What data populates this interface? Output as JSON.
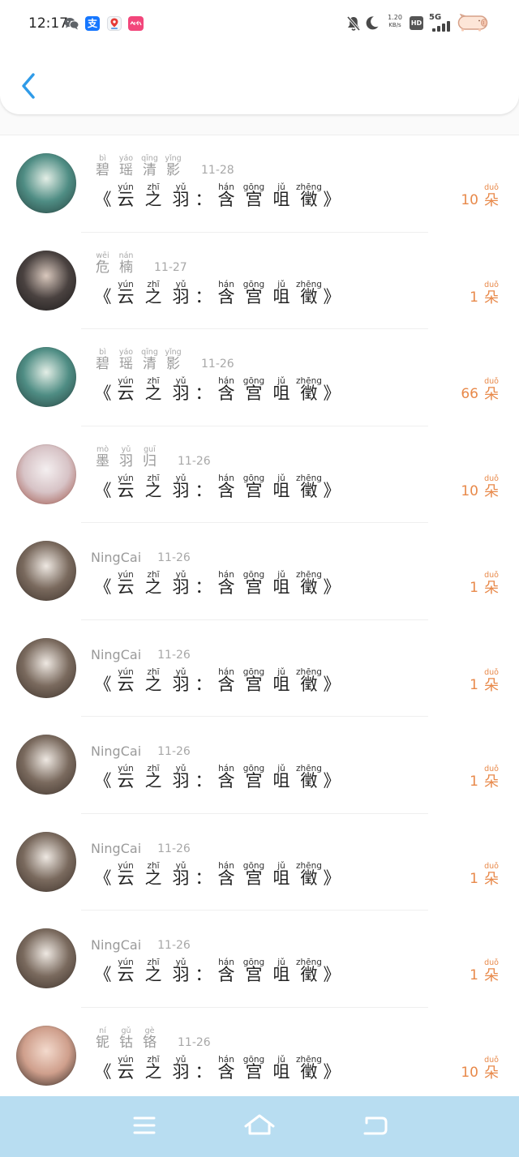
{
  "status_bar": {
    "time": "12:17",
    "alipay_label": "支",
    "speed_value": "1.20",
    "speed_unit": "KB/s",
    "hd_label": "HD",
    "network_label": "5G",
    "icons": [
      "wechat-icon",
      "alipay-icon",
      "map-pin-icon",
      "pink-app-icon",
      "bell-off-icon",
      "moon-icon",
      "signal-icon",
      "battery-icon"
    ]
  },
  "header": {
    "back_icon": "chevron-left-icon",
    "accent_color": "#2f9be8"
  },
  "list": {
    "count_color": "#e8894a",
    "items": [
      {
        "name": [
          {
            "char": "碧",
            "py": "bì"
          },
          {
            "char": "瑶",
            "py": "yáo"
          },
          {
            "char": "清",
            "py": "qīng"
          },
          {
            "char": "影",
            "py": "yǐng"
          }
        ],
        "date": "11-28",
        "title": [
          {
            "char": "《"
          },
          {
            "char": "云",
            "py": "yún"
          },
          {
            "char": "之",
            "py": "zhī"
          },
          {
            "char": "羽",
            "py": "yǔ"
          },
          {
            "char": "："
          },
          {
            "char": "含",
            "py": "hán"
          },
          {
            "char": "宫",
            "py": "gōng"
          },
          {
            "char": "咀",
            "py": "jǔ"
          },
          {
            "char": "徵",
            "py": "zhēng"
          },
          {
            "char": "》"
          }
        ],
        "count": "10",
        "unit": {
          "char": "朵",
          "py": "duǒ"
        },
        "avatar_colors": [
          "#e3eee6",
          "#4f8d84",
          "#24403d"
        ]
      },
      {
        "name": [
          {
            "char": "危",
            "py": "wēi"
          },
          {
            "char": "楠",
            "py": "nán"
          }
        ],
        "date": "11-27",
        "title": [
          {
            "char": "《"
          },
          {
            "char": "云",
            "py": "yún"
          },
          {
            "char": "之",
            "py": "zhī"
          },
          {
            "char": "羽",
            "py": "yǔ"
          },
          {
            "char": "："
          },
          {
            "char": "含",
            "py": "hán"
          },
          {
            "char": "宫",
            "py": "gōng"
          },
          {
            "char": "咀",
            "py": "jǔ"
          },
          {
            "char": "徵",
            "py": "zhēng"
          },
          {
            "char": "》"
          }
        ],
        "count": "1",
        "unit": {
          "char": "朵",
          "py": "duǒ"
        },
        "avatar_colors": [
          "#d9c8bd",
          "#4a4240",
          "#1b1a1a"
        ]
      },
      {
        "name": [
          {
            "char": "碧",
            "py": "bì"
          },
          {
            "char": "瑶",
            "py": "yáo"
          },
          {
            "char": "清",
            "py": "qīng"
          },
          {
            "char": "影",
            "py": "yǐng"
          }
        ],
        "date": "11-26",
        "title": [
          {
            "char": "《"
          },
          {
            "char": "云",
            "py": "yún"
          },
          {
            "char": "之",
            "py": "zhī"
          },
          {
            "char": "羽",
            "py": "yǔ"
          },
          {
            "char": "："
          },
          {
            "char": "含",
            "py": "hán"
          },
          {
            "char": "宫",
            "py": "gōng"
          },
          {
            "char": "咀",
            "py": "jǔ"
          },
          {
            "char": "徵",
            "py": "zhēng"
          },
          {
            "char": "》"
          }
        ],
        "count": "66",
        "unit": {
          "char": "朵",
          "py": "duǒ"
        },
        "avatar_colors": [
          "#e3eee6",
          "#4f8d84",
          "#24403d"
        ]
      },
      {
        "name": [
          {
            "char": "墨",
            "py": "mò"
          },
          {
            "char": "羽",
            "py": "yǔ"
          },
          {
            "char": "归",
            "py": "guī"
          }
        ],
        "date": "11-26",
        "title": [
          {
            "char": "《"
          },
          {
            "char": "云",
            "py": "yún"
          },
          {
            "char": "之",
            "py": "zhī"
          },
          {
            "char": "羽",
            "py": "yǔ"
          },
          {
            "char": "："
          },
          {
            "char": "含",
            "py": "hán"
          },
          {
            "char": "宫",
            "py": "gōng"
          },
          {
            "char": "咀",
            "py": "jǔ"
          },
          {
            "char": "徵",
            "py": "zhēng"
          },
          {
            "char": "》"
          }
        ],
        "count": "10",
        "unit": {
          "char": "朵",
          "py": "duǒ"
        },
        "avatar_colors": [
          "#f4eff0",
          "#d7c3c6",
          "#9b4b40"
        ]
      },
      {
        "name": [
          {
            "char": "NingCai"
          }
        ],
        "date": "11-26",
        "title": [
          {
            "char": "《"
          },
          {
            "char": "云",
            "py": "yún"
          },
          {
            "char": "之",
            "py": "zhī"
          },
          {
            "char": "羽",
            "py": "yǔ"
          },
          {
            "char": "："
          },
          {
            "char": "含",
            "py": "hán"
          },
          {
            "char": "宫",
            "py": "gōng"
          },
          {
            "char": "咀",
            "py": "jǔ"
          },
          {
            "char": "徵",
            "py": "zhēng"
          },
          {
            "char": "》"
          }
        ],
        "count": "1",
        "unit": {
          "char": "朵",
          "py": "duǒ"
        },
        "avatar_colors": [
          "#eee8e2",
          "#7a6a5e",
          "#3b3029"
        ]
      },
      {
        "name": [
          {
            "char": "NingCai"
          }
        ],
        "date": "11-26",
        "title": [
          {
            "char": "《"
          },
          {
            "char": "云",
            "py": "yún"
          },
          {
            "char": "之",
            "py": "zhī"
          },
          {
            "char": "羽",
            "py": "yǔ"
          },
          {
            "char": "："
          },
          {
            "char": "含",
            "py": "hán"
          },
          {
            "char": "宫",
            "py": "gōng"
          },
          {
            "char": "咀",
            "py": "jǔ"
          },
          {
            "char": "徵",
            "py": "zhēng"
          },
          {
            "char": "》"
          }
        ],
        "count": "1",
        "unit": {
          "char": "朵",
          "py": "duǒ"
        },
        "avatar_colors": [
          "#eee8e2",
          "#7a6a5e",
          "#3b3029"
        ]
      },
      {
        "name": [
          {
            "char": "NingCai"
          }
        ],
        "date": "11-26",
        "title": [
          {
            "char": "《"
          },
          {
            "char": "云",
            "py": "yún"
          },
          {
            "char": "之",
            "py": "zhī"
          },
          {
            "char": "羽",
            "py": "yǔ"
          },
          {
            "char": "："
          },
          {
            "char": "含",
            "py": "hán"
          },
          {
            "char": "宫",
            "py": "gōng"
          },
          {
            "char": "咀",
            "py": "jǔ"
          },
          {
            "char": "徵",
            "py": "zhēng"
          },
          {
            "char": "》"
          }
        ],
        "count": "1",
        "unit": {
          "char": "朵",
          "py": "duǒ"
        },
        "avatar_colors": [
          "#eee8e2",
          "#7a6a5e",
          "#3b3029"
        ]
      },
      {
        "name": [
          {
            "char": "NingCai"
          }
        ],
        "date": "11-26",
        "title": [
          {
            "char": "《"
          },
          {
            "char": "云",
            "py": "yún"
          },
          {
            "char": "之",
            "py": "zhī"
          },
          {
            "char": "羽",
            "py": "yǔ"
          },
          {
            "char": "："
          },
          {
            "char": "含",
            "py": "hán"
          },
          {
            "char": "宫",
            "py": "gōng"
          },
          {
            "char": "咀",
            "py": "jǔ"
          },
          {
            "char": "徵",
            "py": "zhēng"
          },
          {
            "char": "》"
          }
        ],
        "count": "1",
        "unit": {
          "char": "朵",
          "py": "duǒ"
        },
        "avatar_colors": [
          "#eee8e2",
          "#7a6a5e",
          "#3b3029"
        ]
      },
      {
        "name": [
          {
            "char": "NingCai"
          }
        ],
        "date": "11-26",
        "title": [
          {
            "char": "《"
          },
          {
            "char": "云",
            "py": "yún"
          },
          {
            "char": "之",
            "py": "zhī"
          },
          {
            "char": "羽",
            "py": "yǔ"
          },
          {
            "char": "："
          },
          {
            "char": "含",
            "py": "hán"
          },
          {
            "char": "宫",
            "py": "gōng"
          },
          {
            "char": "咀",
            "py": "jǔ"
          },
          {
            "char": "徵",
            "py": "zhēng"
          },
          {
            "char": "》"
          }
        ],
        "count": "1",
        "unit": {
          "char": "朵",
          "py": "duǒ"
        },
        "avatar_colors": [
          "#eee8e2",
          "#7a6a5e",
          "#3b3029"
        ]
      },
      {
        "name": [
          {
            "char": "铌",
            "py": "ní"
          },
          {
            "char": "钴",
            "py": "gǔ"
          },
          {
            "char": "铬",
            "py": "gè"
          }
        ],
        "date": "11-26",
        "title": [
          {
            "char": "《"
          },
          {
            "char": "云",
            "py": "yún"
          },
          {
            "char": "之",
            "py": "zhī"
          },
          {
            "char": "羽",
            "py": "yǔ"
          },
          {
            "char": "："
          },
          {
            "char": "含",
            "py": "hán"
          },
          {
            "char": "宫",
            "py": "gōng"
          },
          {
            "char": "咀",
            "py": "jǔ"
          },
          {
            "char": "徵",
            "py": "zhēng"
          },
          {
            "char": "》"
          }
        ],
        "count": "10",
        "unit": {
          "char": "朵",
          "py": "duǒ"
        },
        "avatar_colors": [
          "#f3dacd",
          "#cf9f8c",
          "#2b231f"
        ]
      }
    ]
  },
  "bottom_nav": {
    "icons": [
      "menu-icon",
      "home-icon",
      "back-icon"
    ],
    "background": "#b8ddf1"
  }
}
